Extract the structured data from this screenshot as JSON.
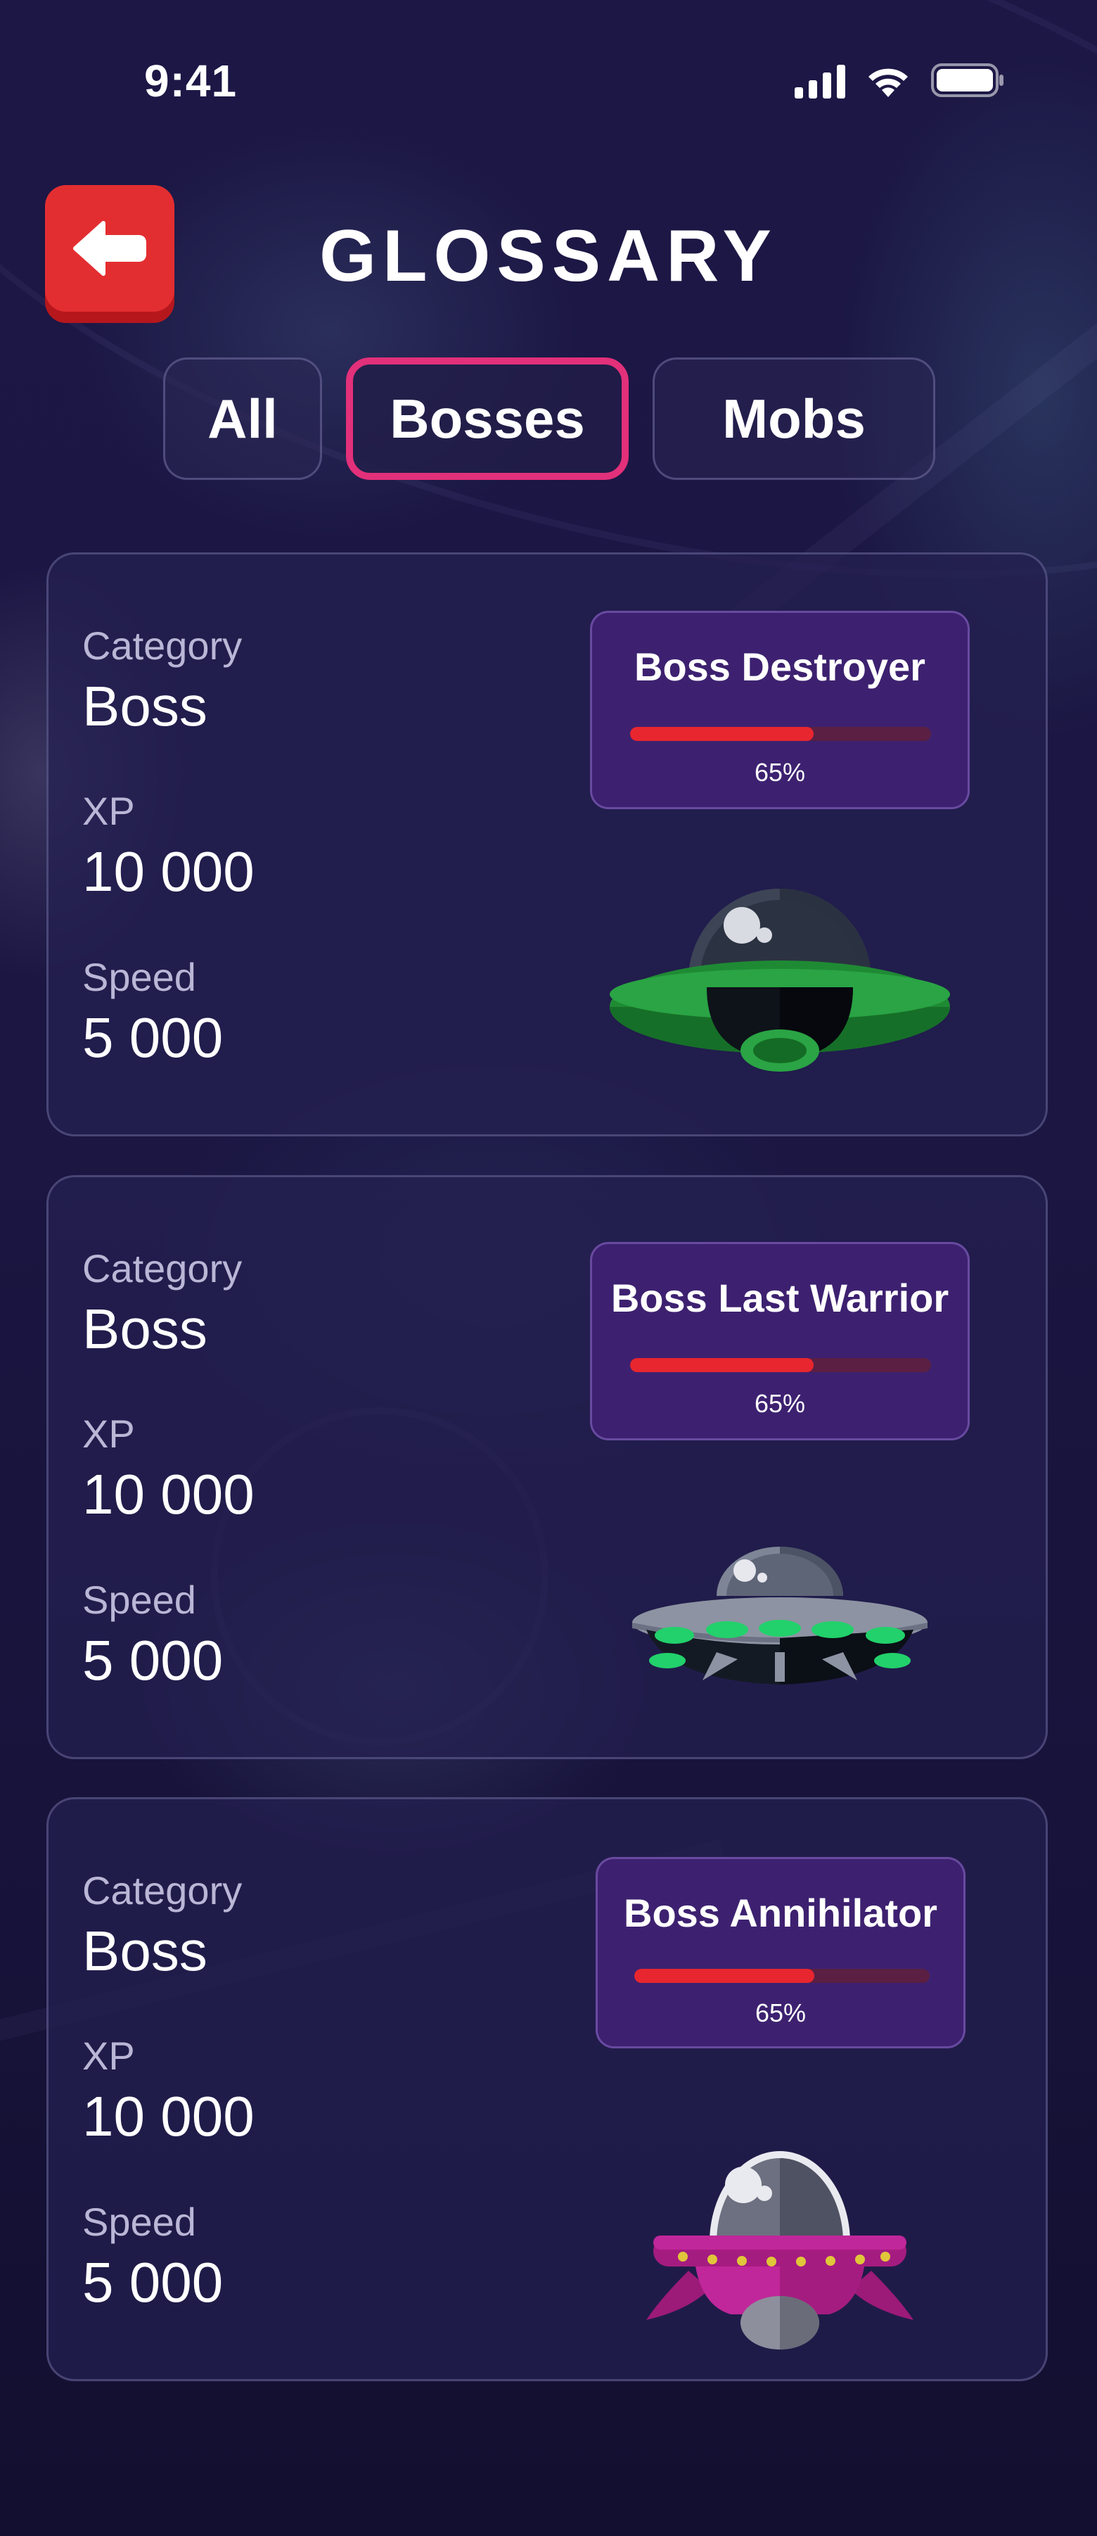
{
  "status_bar": {
    "time": "9:41"
  },
  "header": {
    "title": "GLOSSARY",
    "back_icon": "arrow-left-icon"
  },
  "tabs": [
    {
      "label": "All",
      "active": false
    },
    {
      "label": "Bosses",
      "active": true
    },
    {
      "label": "Mobs",
      "active": false
    }
  ],
  "colors": {
    "background": "#1b1642",
    "accent": "#e2307a",
    "back_button": "#e32e31",
    "panel": "#3d2170",
    "hp_fill": "#e8262f"
  },
  "bosses": [
    {
      "category_label": "Category",
      "category": "Boss",
      "xp_label": "XP",
      "xp": "10 000",
      "speed_label": "Speed",
      "speed": "5 000",
      "name": "Boss Destroyer",
      "hp_text": "65%",
      "hp": 0.61,
      "icon": "green-ufo-icon"
    },
    {
      "category_label": "Category",
      "category": "Boss",
      "xp_label": "XP",
      "xp": "10 000",
      "speed_label": "Speed",
      "speed": "5 000",
      "name": "Boss Last Warrior",
      "hp_text": "65%",
      "hp": 0.61,
      "icon": "grey-ufo-icon"
    },
    {
      "category_label": "Category",
      "category": "Boss",
      "xp_label": "XP",
      "xp": "10 000",
      "speed_label": "Speed",
      "speed": "5 000",
      "name": "Boss Annihilator",
      "hp_text": "65%",
      "hp": 0.61,
      "icon": "pink-ufo-icon"
    }
  ]
}
